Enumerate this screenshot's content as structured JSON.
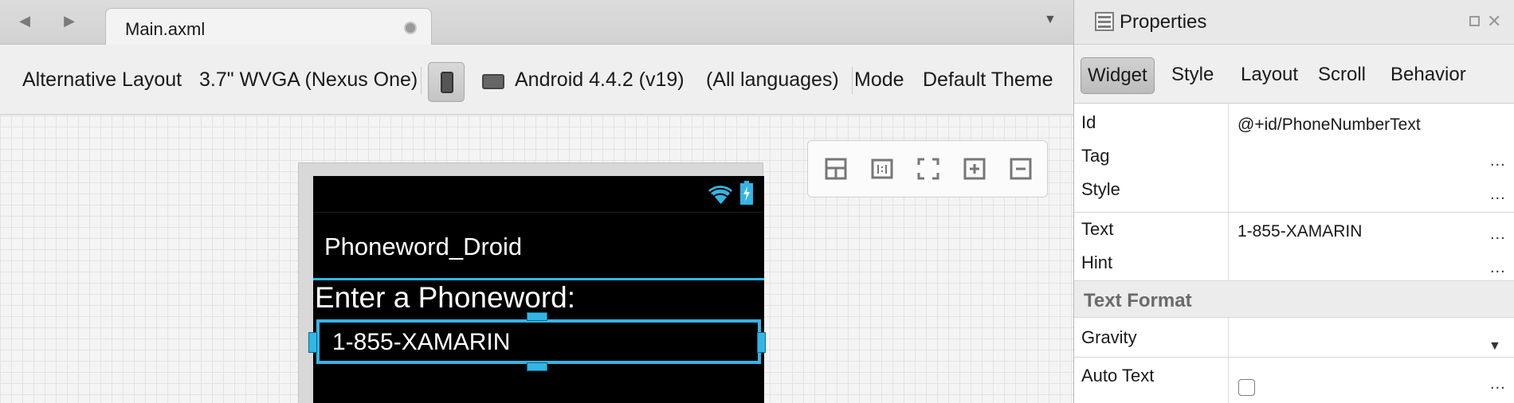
{
  "tabbar": {
    "back_icon": "chevron-left-icon",
    "forward_icon": "chevron-right-icon",
    "document_tab": "Main.axml",
    "overflow_icon": "dropdown-triangle-icon"
  },
  "toolbar": {
    "alternative_layout": "Alternative Layout",
    "device": "3.7\" WVGA (Nexus One)",
    "android_version": "Android 4.4.2 (v19)",
    "languages": "(All languages)",
    "mode": "Mode",
    "theme": "Default Theme"
  },
  "device_preview": {
    "app_title": "Phoneword_Droid",
    "label": "Enter a Phoneword:",
    "phone_field_value": "1-855-XAMARIN",
    "colors": {
      "accent": "#33b5e5",
      "screen": "#000000"
    }
  },
  "properties": {
    "title": "Properties",
    "tabs": [
      "Widget",
      "Style",
      "Layout",
      "Scroll",
      "Behavior"
    ],
    "active_tab": "Widget",
    "rows": {
      "id": {
        "label": "Id",
        "value": "@+id/PhoneNumberText"
      },
      "tag": {
        "label": "Tag",
        "value": ""
      },
      "style": {
        "label": "Style",
        "value": ""
      },
      "text": {
        "label": "Text",
        "value": "1-855-XAMARIN"
      },
      "hint": {
        "label": "Hint",
        "value": ""
      }
    },
    "section_text_format": "Text Format",
    "gravity": {
      "label": "Gravity",
      "value": ""
    },
    "auto_text": {
      "label": "Auto Text",
      "checked": false
    },
    "ellipsis": "..."
  }
}
